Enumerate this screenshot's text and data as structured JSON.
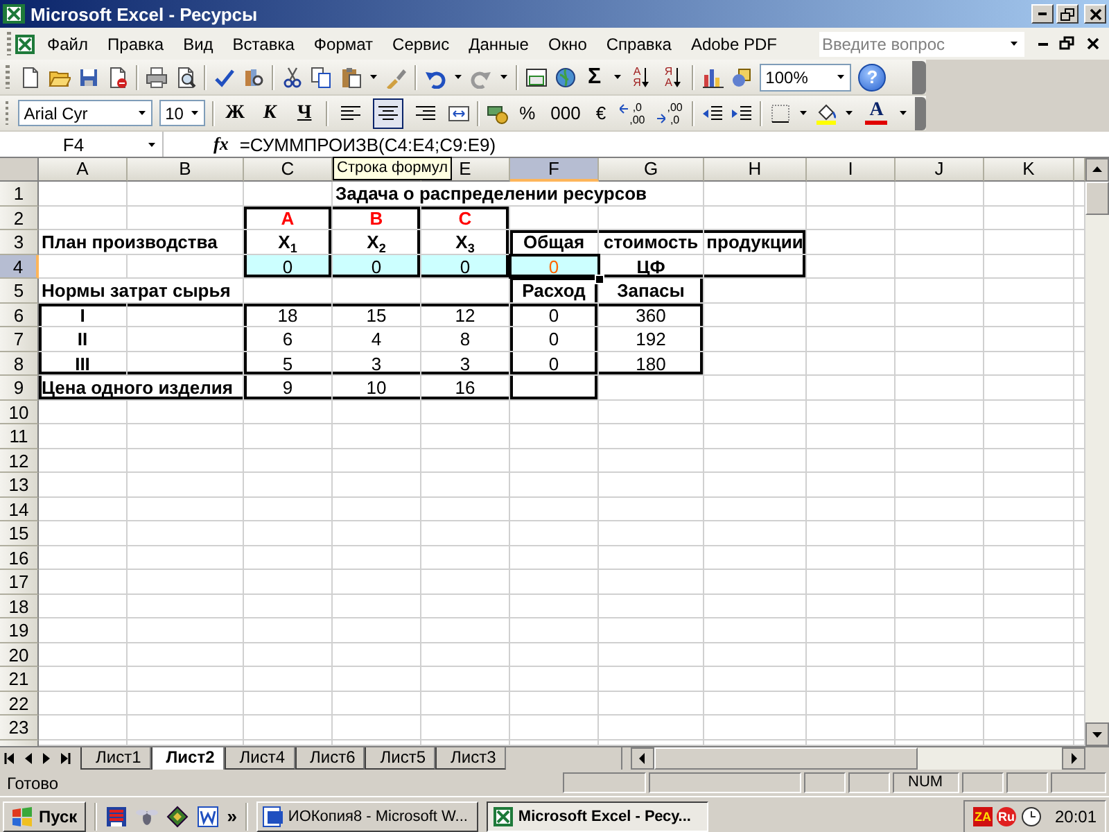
{
  "window": {
    "title": "Microsoft Excel - Ресурсы"
  },
  "menu": {
    "items": [
      "Файл",
      "Правка",
      "Вид",
      "Вставка",
      "Формат",
      "Сервис",
      "Данные",
      "Окно",
      "Справка",
      "Adobe PDF"
    ],
    "help_search": {
      "placeholder": "Введите вопрос"
    }
  },
  "standard_toolbar": {
    "autosum": "Σ",
    "sort": [
      {
        "top": "А",
        "bottom": "Я"
      },
      {
        "top": "Я",
        "bottom": "А"
      }
    ],
    "zoom": "100%",
    "help": "?"
  },
  "formatting_toolbar": {
    "font": "Arial Cyr",
    "size": "10",
    "styles": [
      {
        "label": "Ж",
        "kind": "bold"
      },
      {
        "label": "К",
        "kind": "italic"
      },
      {
        "label": "Ч",
        "kind": "underline"
      }
    ],
    "alignment": [
      {
        "selected": false
      },
      {
        "selected": true
      },
      {
        "selected": false
      }
    ],
    "number_formats": [
      "%",
      "000",
      "€"
    ],
    "decimals": [
      {
        "kind": "increase",
        "top": ",0",
        "bottom": ",00"
      },
      {
        "kind": "decrease",
        "top": ",00",
        "bottom": ",0"
      }
    ],
    "font_color": "A"
  },
  "formula_bar": {
    "name_box": "F4",
    "fx": "fx",
    "formula": "=СУММПРОИЗВ(C4:E4;C9:E9)"
  },
  "tooltip": "Строка формул",
  "sheet": {
    "columns": [
      {
        "label": "A",
        "selected": false
      },
      {
        "label": "B",
        "selected": false
      },
      {
        "label": "C",
        "selected": false
      },
      {
        "selected": false
      },
      {
        "label": "E",
        "selected": false
      },
      {
        "label": "F",
        "selected": true
      },
      {
        "label": "G",
        "selected": false
      },
      {
        "label": "H",
        "selected": false
      },
      {
        "label": "I",
        "selected": false
      },
      {
        "label": "J",
        "selected": false
      },
      {
        "label": "K",
        "selected": false
      }
    ],
    "rows": [
      {
        "number": "1",
        "selected": false,
        "cells": [
          {},
          {},
          {},
          {
            "text": "Задача о распределении ресурсов",
            "bold": true
          }
        ]
      },
      {
        "number": "2",
        "selected": false,
        "cells": [
          {},
          {},
          {
            "text": "A",
            "bold": true,
            "centered": true,
            "color": "#ff0000",
            "border": {
              "top": true,
              "left": true,
              "right": true
            }
          },
          {
            "text": "B",
            "bold": true,
            "centered": true,
            "color": "#ff0000",
            "border": {
              "top": true,
              "right": true
            }
          },
          {
            "text": "C",
            "bold": true,
            "centered": true,
            "color": "#ff0000",
            "border": {
              "top": true,
              "right": true
            }
          }
        ]
      },
      {
        "number": "3",
        "selected": false,
        "cells": [
          {
            "text": "План производства",
            "bold": true
          },
          {},
          {
            "text": "X$_{1}$",
            "bold": true,
            "centered": true,
            "border": {
              "left": true,
              "right": true
            }
          },
          {
            "text": "X$_{2}$",
            "bold": true,
            "centered": true,
            "border": {
              "right": true
            }
          },
          {
            "text": "X$_{3}$",
            "bold": true,
            "centered": true,
            "border": {
              "right": true
            }
          },
          {
            "text": "Общая",
            "bold": true,
            "centered": true,
            "border": {
              "top": true,
              "left": true
            }
          },
          {
            "text": "стоимость",
            "bold": true,
            "centered": true,
            "border": {
              "top": true
            }
          },
          {
            "text": "продукции",
            "bold": true,
            "centered": true,
            "border": {
              "top": true,
              "right": true
            }
          }
        ]
      },
      {
        "number": "4",
        "selected": true,
        "cells": [
          {},
          {},
          {
            "text": "0",
            "centered": true,
            "shaded": true,
            "border": {
              "left": true,
              "right": true,
              "bottom": true
            }
          },
          {
            "text": "0",
            "centered": true,
            "shaded": true,
            "border": {
              "right": true,
              "bottom": true
            }
          },
          {
            "text": "0",
            "centered": true,
            "shaded": true,
            "border": {
              "right": true,
              "bottom": true
            }
          },
          {
            "text": "0",
            "centered": true,
            "shaded": true,
            "color": "#ff6600",
            "border": {
              "bottom": true
            }
          },
          {
            "text": "ЦФ",
            "bold": true,
            "centered": true,
            "border": {
              "bottom": true
            }
          },
          {
            "border": {
              "right": true,
              "bottom": true
            }
          }
        ]
      },
      {
        "number": "5",
        "selected": false,
        "cells": [
          {
            "text": "Нормы затрат сырья",
            "bold": true
          },
          {},
          {},
          {},
          {},
          {
            "text": "Расход",
            "bold": true,
            "centered": true,
            "border": {
              "left": true,
              "right": true
            }
          },
          {
            "text": "Запасы",
            "bold": true,
            "centered": true,
            "border": {
              "right": true
            }
          }
        ]
      },
      {
        "number": "6",
        "selected": false,
        "cells": [
          {
            "text": "I",
            "bold": true,
            "centered": true,
            "border": {
              "top": true,
              "left": true
            }
          },
          {
            "border": {
              "top": true
            }
          },
          {
            "text": "18",
            "centered": true,
            "border": {
              "top": true,
              "left": true
            }
          },
          {
            "text": "15",
            "centered": true,
            "border": {
              "top": true
            }
          },
          {
            "text": "12",
            "centered": true,
            "border": {
              "top": true
            }
          },
          {
            "text": "0",
            "centered": true,
            "border": {
              "top": true,
              "left": true,
              "right": true
            }
          },
          {
            "text": "360",
            "centered": true,
            "border": {
              "top": true,
              "right": true
            }
          }
        ]
      },
      {
        "number": "7",
        "selected": false,
        "cells": [
          {
            "text": "II",
            "bold": true,
            "centered": true,
            "border": {
              "left": true
            }
          },
          {},
          {
            "text": "6",
            "centered": true,
            "border": {
              "left": true
            }
          },
          {
            "text": "4",
            "centered": true
          },
          {
            "text": "8",
            "centered": true
          },
          {
            "text": "0",
            "centered": true,
            "border": {
              "left": true,
              "right": true
            }
          },
          {
            "text": "192",
            "centered": true,
            "border": {
              "right": true
            }
          }
        ]
      },
      {
        "number": "8",
        "selected": false,
        "cells": [
          {
            "text": "III",
            "bold": true,
            "centered": true,
            "border": {
              "left": true,
              "bottom": true
            }
          },
          {
            "border": {
              "bottom": true
            }
          },
          {
            "text": "5",
            "centered": true,
            "border": {
              "left": true,
              "bottom": true
            }
          },
          {
            "text": "3",
            "centered": true,
            "border": {
              "bottom": true
            }
          },
          {
            "text": "3",
            "centered": true,
            "border": {
              "bottom": true
            }
          },
          {
            "text": "0",
            "centered": true,
            "border": {
              "left": true,
              "right": true,
              "bottom": true
            }
          },
          {
            "text": "180",
            "centered": true,
            "border": {
              "right": true,
              "bottom": true
            }
          }
        ]
      },
      {
        "number": "9",
        "selected": false,
        "cells": [
          {
            "text": "Цена одного изделия",
            "bold": true,
            "border": {
              "left": true,
              "bottom": true
            }
          },
          {
            "border": {
              "bottom": true
            }
          },
          {
            "text": "9",
            "centered": true,
            "border": {
              "left": true,
              "bottom": true
            }
          },
          {
            "text": "10",
            "centered": true,
            "border": {
              "bottom": true
            }
          },
          {
            "text": "16",
            "centered": true,
            "border": {
              "bottom": true
            }
          },
          {
            "border": {
              "left": true,
              "right": true,
              "bottom": true
            }
          }
        ]
      },
      {
        "number": "10",
        "selected": false
      },
      {
        "number": "11",
        "selected": false
      },
      {
        "number": "12",
        "selected": false
      },
      {
        "number": "13",
        "selected": false
      },
      {
        "number": "14",
        "selected": false
      },
      {
        "number": "15",
        "selected": false
      },
      {
        "number": "16",
        "selected": false
      },
      {
        "number": "17",
        "selected": false
      },
      {
        "number": "18",
        "selected": false
      },
      {
        "number": "19",
        "selected": false
      },
      {
        "number": "20",
        "selected": false
      },
      {
        "number": "21",
        "selected": false
      },
      {
        "number": "22",
        "selected": false
      },
      {
        "number": "23",
        "selected": false
      }
    ]
  },
  "sheet_tabs": [
    {
      "label": "Лист1",
      "selected": false
    },
    {
      "label": "Лист2",
      "selected": true
    },
    {
      "label": "Лист4",
      "selected": false
    },
    {
      "label": "Лист6",
      "selected": false
    },
    {
      "label": "Лист5",
      "selected": false
    },
    {
      "label": "Лист3",
      "selected": false
    }
  ],
  "status_bar": {
    "text": "Готово",
    "indicators": [
      "NUM"
    ]
  },
  "taskbar": {
    "start": "Пуск",
    "more": "»",
    "tasks": [
      {
        "label": "ИОКопия8 - Microsoft W...",
        "kind": "word",
        "selected": false
      },
      {
        "label": "Microsoft Excel - Ресу...",
        "kind": "excel",
        "selected": true
      }
    ],
    "tray": [
      "ZA",
      "Ru"
    ],
    "clock": "20:01"
  }
}
